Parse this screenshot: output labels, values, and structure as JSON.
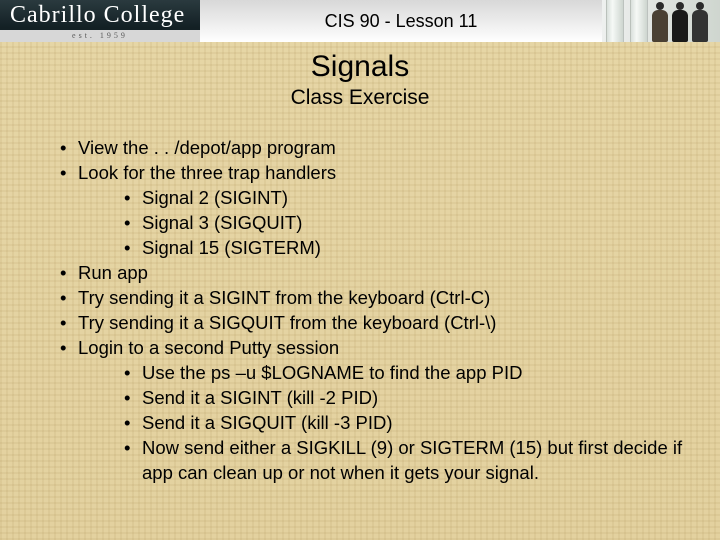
{
  "header": {
    "logo_text": "Cabrillo College",
    "est_text": "est. 1959",
    "course_title": "CIS 90 - Lesson 11"
  },
  "slide": {
    "title": "Signals",
    "subtitle": "Class Exercise",
    "bullets": {
      "b1": "View the . . /depot/app program",
      "b2": "Look for the three trap handlers",
      "b2_children": {
        "c1": "Signal 2 (SIGINT)",
        "c2": "Signal 3 (SIGQUIT)",
        "c3": "Signal 15 (SIGTERM)"
      },
      "b3": "Run app",
      "b4": "Try sending it a SIGINT from the keyboard (Ctrl-C)",
      "b5": "Try sending it a SIGQUIT from the keyboard (Ctrl-\\)",
      "b6": "Login to a second Putty session",
      "b6_children": {
        "c1": "Use the ps –u $LOGNAME to find the app PID",
        "c2": "Send it a SIGINT (kill -2 PID)",
        "c3": "Send it a SIGQUIT (kill -3 PID)",
        "c4": "Now send either a SIGKILL (9) or SIGTERM (15) but first decide if app can clean up or not when it gets your signal."
      }
    }
  }
}
